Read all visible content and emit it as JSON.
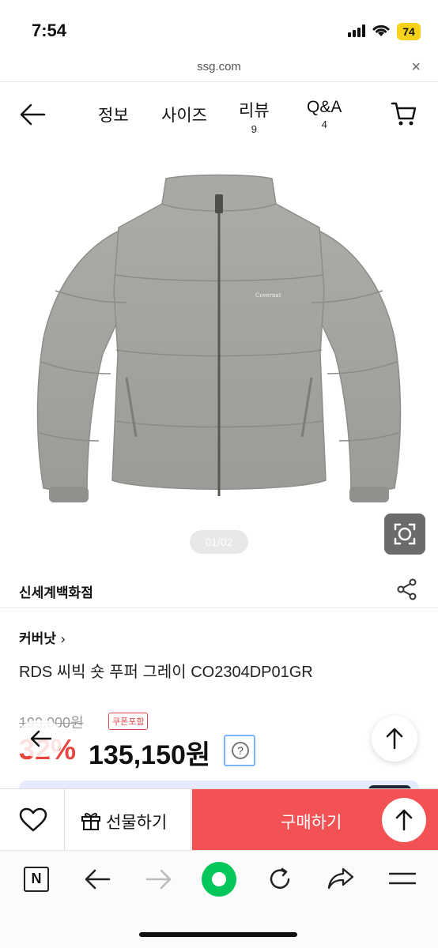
{
  "status_bar": {
    "time": "7:54",
    "battery": "74"
  },
  "browser": {
    "url": "ssg.com",
    "close_symbol": "×"
  },
  "nav": {
    "tabs": [
      {
        "label": "정보",
        "count": ""
      },
      {
        "label": "사이즈",
        "count": ""
      },
      {
        "label": "리뷰",
        "count": "9"
      },
      {
        "label": "Q&A",
        "count": "4"
      }
    ]
  },
  "gallery": {
    "pager": "01/02",
    "brand_mark_on_jacket": "Covernat"
  },
  "store": {
    "name": "신세계백화점"
  },
  "product": {
    "brand": "커버낫",
    "brand_chevron": "›",
    "name": "RDS 씨빅 숏 푸퍼 그레이 CO2304DP01GR",
    "original_price": "199,000원",
    "coupon_badge": "쿠폰포함",
    "discount": "32%",
    "sale_price": "135,150원",
    "help_symbol": "?"
  },
  "buy_bar": {
    "gift_label": "선물하기",
    "buy_label": "구매하기"
  },
  "toolbar": {
    "n_label": "N"
  },
  "colors": {
    "accent_red": "#f25254",
    "discount_red": "#e8453c",
    "naver_green": "#03c75a"
  },
  "icons": [
    "back-arrow-icon",
    "cart-icon",
    "lens-icon",
    "share-icon",
    "heart-icon",
    "gift-icon",
    "arrow-up-icon",
    "naver-n-icon",
    "forward-arrow-icon",
    "green-home-icon",
    "reload-icon",
    "share-arrow-icon",
    "menu-icon"
  ]
}
